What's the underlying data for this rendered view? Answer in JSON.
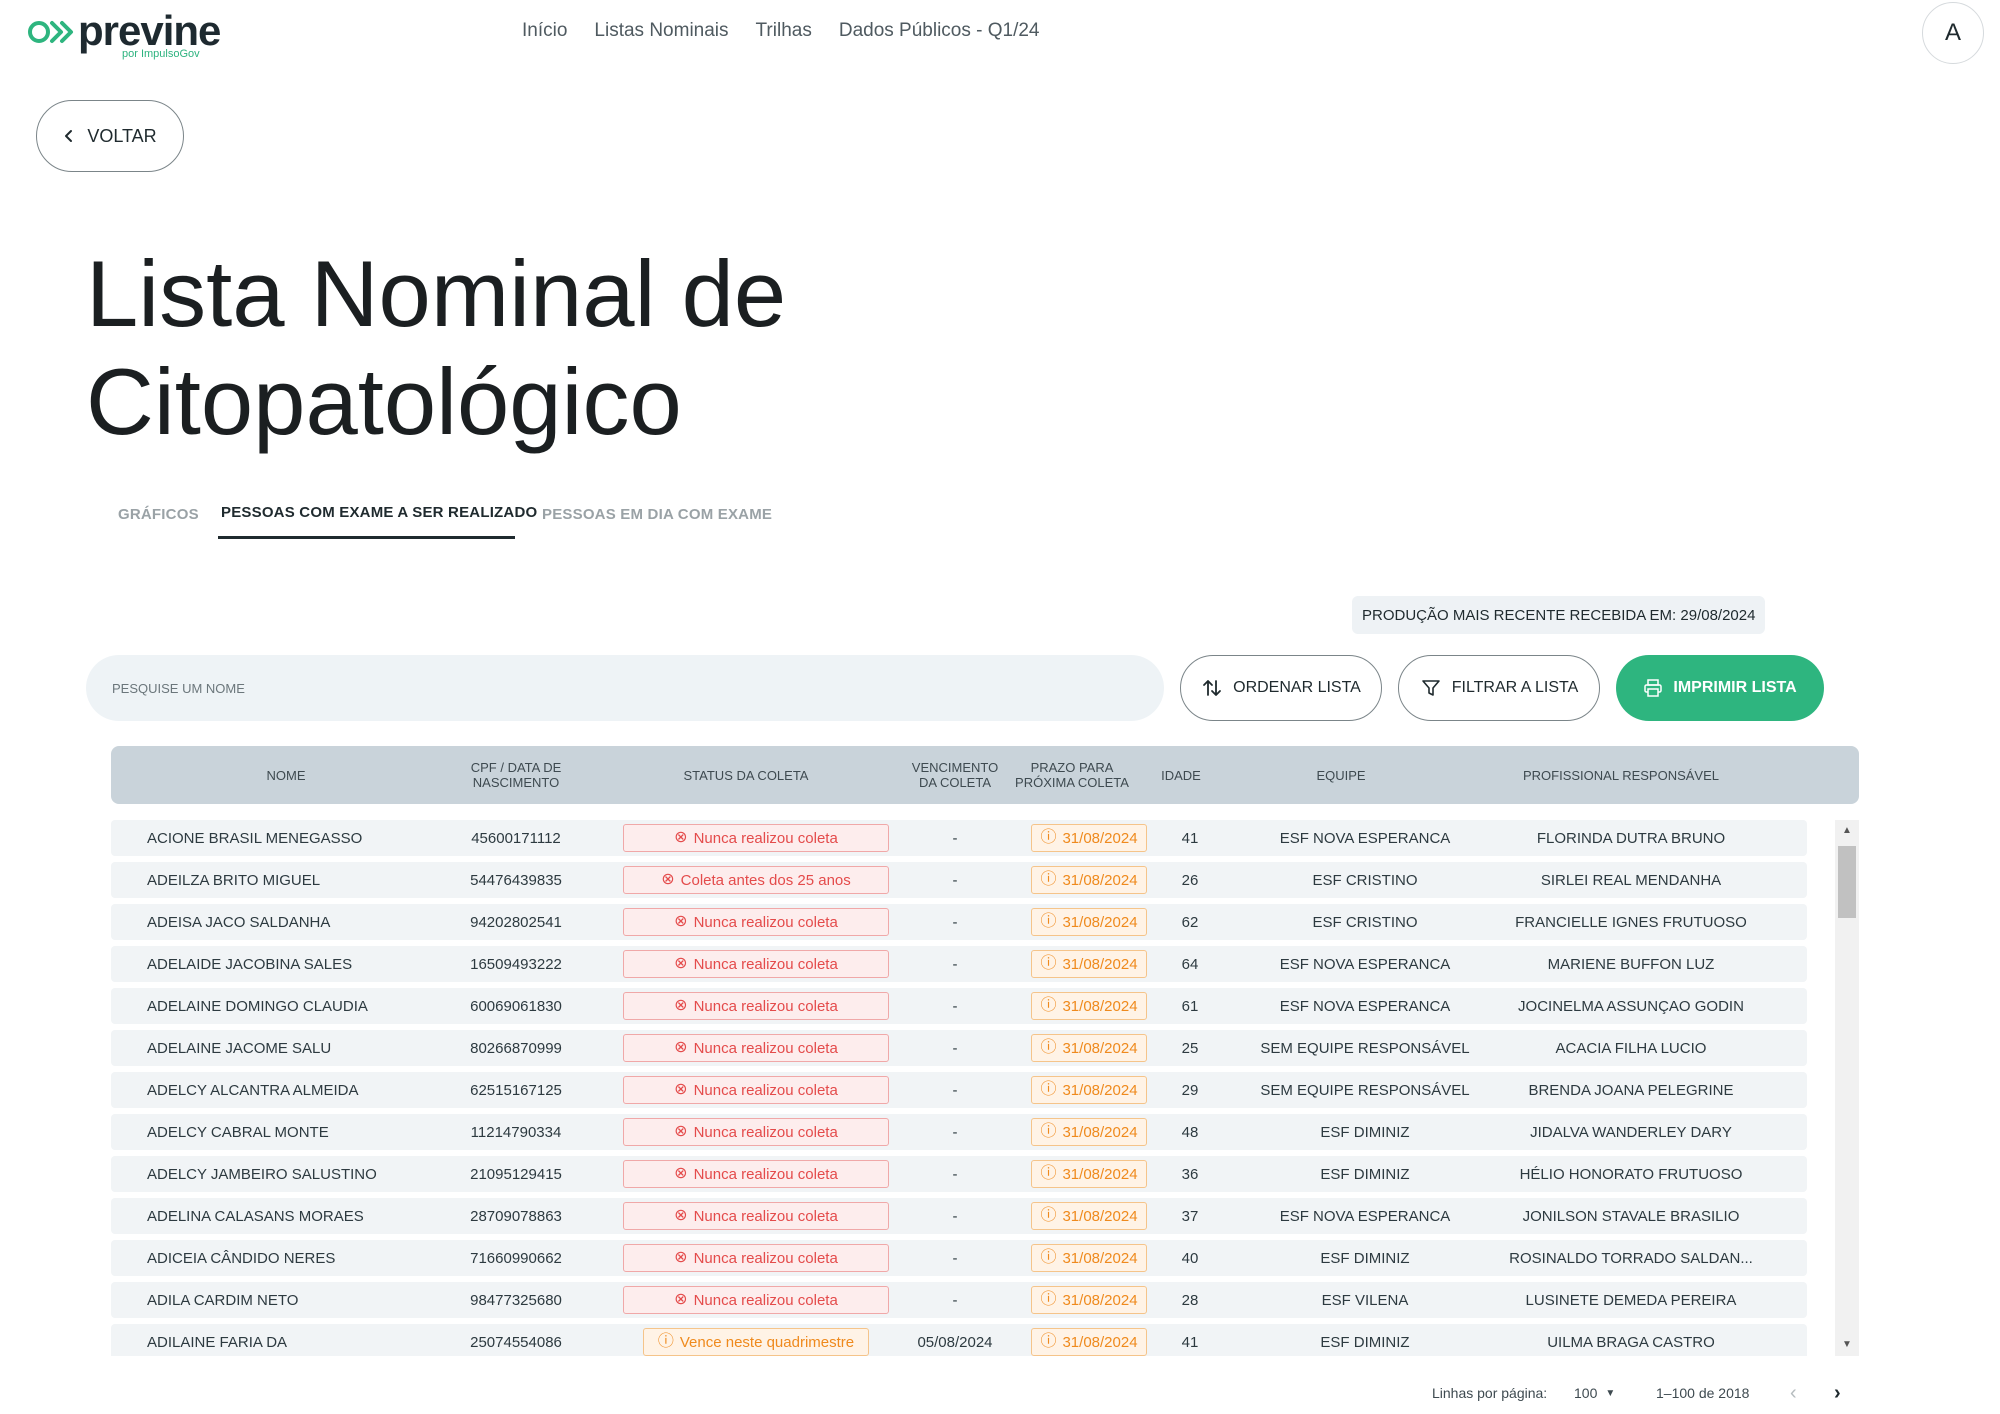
{
  "brand": {
    "name": "previne",
    "subtitle": "por ImpulsoGov",
    "mark_color": "#2eb57f"
  },
  "nav": [
    {
      "label": "Início"
    },
    {
      "label": "Listas Nominais"
    },
    {
      "label": "Trilhas"
    },
    {
      "label": "Dados Públicos - Q1/24"
    }
  ],
  "user": {
    "avatar_letter": "A"
  },
  "back_button": {
    "label": "VOLTAR",
    "icon": "chevron-left-icon"
  },
  "page": {
    "title": "Lista Nominal de Citopatológico"
  },
  "tabs": [
    {
      "label": "GRÁFICOS",
      "active": false
    },
    {
      "label": "PESSOAS COM EXAME A SER REALIZADO",
      "active": true
    },
    {
      "label": "PESSOAS EM DIA COM EXAME",
      "active": false
    }
  ],
  "recent_production": "PRODUÇÃO MAIS RECENTE RECEBIDA EM: 29/08/2024",
  "search": {
    "placeholder": "PESQUISE UM NOME",
    "value": ""
  },
  "actions": {
    "sort": {
      "label": "ORDENAR LISTA",
      "icon": "sort-arrows-icon"
    },
    "filter": {
      "label": "FILTRAR A LISTA",
      "icon": "filter-funnel-icon"
    },
    "print": {
      "label": "IMPRIMIR LISTA",
      "icon": "printer-icon"
    }
  },
  "colors": {
    "primary": "#2eb57f",
    "header_bg": "#c9d3da",
    "status_red": "#e44b4b",
    "status_orange": "#ef8a1d"
  },
  "table": {
    "columns": [
      "NOME",
      "CPF / DATA DE NASCIMENTO",
      "STATUS DA COLETA",
      "VENCIMENTO DA COLETA",
      "PRAZO PARA PRÓXIMA COLETA",
      "IDADE",
      "EQUIPE",
      "PROFISSIONAL RESPONSÁVEL"
    ],
    "rows": [
      {
        "nome": "ACIONE BRASIL MENEGASSO",
        "cpf": "45600171112",
        "status": "Nunca realizou coleta",
        "status_type": "red",
        "vencimento": "-",
        "prazo": "31/08/2024",
        "idade": "41",
        "equipe": "ESF NOVA ESPERANCA",
        "profissional": "FLORINDA DUTRA BRUNO"
      },
      {
        "nome": "ADEILZA BRITO MIGUEL",
        "cpf": "54476439835",
        "status": "Coleta antes dos 25 anos",
        "status_type": "red",
        "vencimento": "-",
        "prazo": "31/08/2024",
        "idade": "26",
        "equipe": "ESF CRISTINO",
        "profissional": "SIRLEI REAL MENDANHA"
      },
      {
        "nome": "ADEISA JACO SALDANHA",
        "cpf": "94202802541",
        "status": "Nunca realizou coleta",
        "status_type": "red",
        "vencimento": "-",
        "prazo": "31/08/2024",
        "idade": "62",
        "equipe": "ESF CRISTINO",
        "profissional": "FRANCIELLE IGNES FRUTUOSO"
      },
      {
        "nome": "ADELAIDE JACOBINA SALES",
        "cpf": "16509493222",
        "status": "Nunca realizou coleta",
        "status_type": "red",
        "vencimento": "-",
        "prazo": "31/08/2024",
        "idade": "64",
        "equipe": "ESF NOVA ESPERANCA",
        "profissional": "MARIENE BUFFON LUZ"
      },
      {
        "nome": "ADELAINE DOMINGO CLAUDIA",
        "cpf": "60069061830",
        "status": "Nunca realizou coleta",
        "status_type": "red",
        "vencimento": "-",
        "prazo": "31/08/2024",
        "idade": "61",
        "equipe": "ESF NOVA ESPERANCA",
        "profissional": "JOCINELMA ASSUNÇAO GODIN"
      },
      {
        "nome": "ADELAINE JACOME SALU",
        "cpf": "80266870999",
        "status": "Nunca realizou coleta",
        "status_type": "red",
        "vencimento": "-",
        "prazo": "31/08/2024",
        "idade": "25",
        "equipe": "SEM EQUIPE RESPONSÁVEL",
        "profissional": "ACACIA FILHA LUCIO"
      },
      {
        "nome": "ADELCY ALCANTRA ALMEIDA",
        "cpf": "62515167125",
        "status": "Nunca realizou coleta",
        "status_type": "red",
        "vencimento": "-",
        "prazo": "31/08/2024",
        "idade": "29",
        "equipe": "SEM EQUIPE RESPONSÁVEL",
        "profissional": "BRENDA JOANA PELEGRINE"
      },
      {
        "nome": "ADELCY CABRAL MONTE",
        "cpf": "11214790334",
        "status": "Nunca realizou coleta",
        "status_type": "red",
        "vencimento": "-",
        "prazo": "31/08/2024",
        "idade": "48",
        "equipe": "ESF DIMINIZ",
        "profissional": "JIDALVA WANDERLEY DARY"
      },
      {
        "nome": "ADELCY JAMBEIRO SALUSTINO",
        "cpf": "21095129415",
        "status": "Nunca realizou coleta",
        "status_type": "red",
        "vencimento": "-",
        "prazo": "31/08/2024",
        "idade": "36",
        "equipe": "ESF DIMINIZ",
        "profissional": "HÉLIO HONORATO FRUTUOSO"
      },
      {
        "nome": "ADELINA CALASANS MORAES",
        "cpf": "28709078863",
        "status": "Nunca realizou coleta",
        "status_type": "red",
        "vencimento": "-",
        "prazo": "31/08/2024",
        "idade": "37",
        "equipe": "ESF NOVA ESPERANCA",
        "profissional": "JONILSON STAVALE BRASILIO"
      },
      {
        "nome": "ADICEIA CÂNDIDO NERES",
        "cpf": "71660990662",
        "status": "Nunca realizou coleta",
        "status_type": "red",
        "vencimento": "-",
        "prazo": "31/08/2024",
        "idade": "40",
        "equipe": "ESF DIMINIZ",
        "profissional": "ROSINALDO TORRADO SALDAN..."
      },
      {
        "nome": "ADILA CARDIM NETO",
        "cpf": "98477325680",
        "status": "Nunca realizou coleta",
        "status_type": "red",
        "vencimento": "-",
        "prazo": "31/08/2024",
        "idade": "28",
        "equipe": "ESF VILENA",
        "profissional": "LUSINETE DEMEDA PEREIRA"
      },
      {
        "nome": "ADILAINE FARIA DA",
        "cpf": "25074554086",
        "status": "Vence neste quadrimestre",
        "status_type": "orange",
        "vencimento": "05/08/2024",
        "prazo": "31/08/2024",
        "idade": "41",
        "equipe": "ESF DIMINIZ",
        "profissional": "UILMA BRAGA CASTRO"
      }
    ]
  },
  "pagination": {
    "rows_per_page_label": "Linhas por página:",
    "rows_per_page": "100",
    "range": "1–100 de 2018"
  }
}
